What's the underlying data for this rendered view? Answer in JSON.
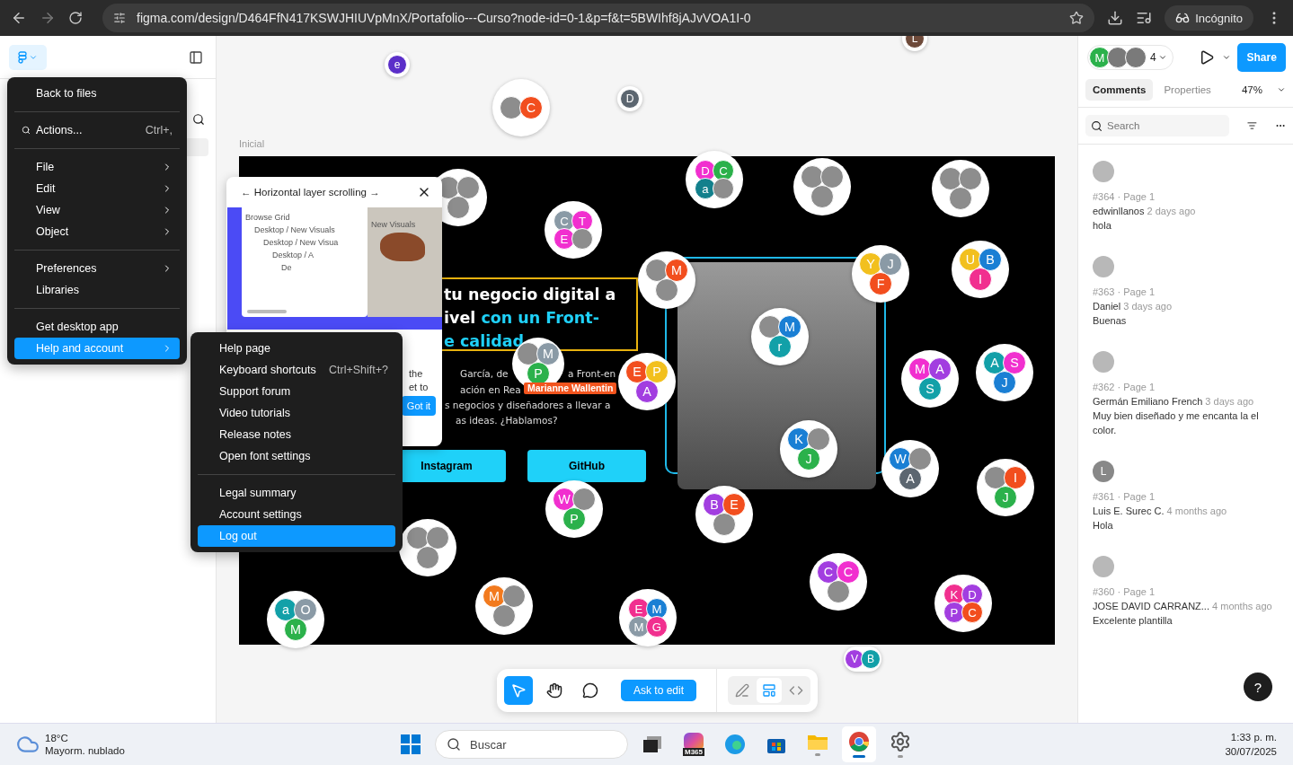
{
  "browser": {
    "url": "figma.com/design/D464FfN417KSWJHIUVpMnX/Portafolio---Curso?node-id=0-1&p=f&t=5BWIhf8jAJvVOA1I-0",
    "profile_label": "Incógnito"
  },
  "main_menu": {
    "groups": [
      [
        {
          "label": "Back to files",
          "submenu": false,
          "selected": false
        }
      ],
      [
        {
          "label": "Actions...",
          "shortcut": "Ctrl+,",
          "kind": "search",
          "submenu": false,
          "selected": false
        }
      ],
      [
        {
          "label": "File",
          "submenu": true,
          "selected": false
        },
        {
          "label": "Edit",
          "submenu": true,
          "selected": false
        },
        {
          "label": "View",
          "submenu": true,
          "selected": false
        },
        {
          "label": "Object",
          "submenu": true,
          "selected": false
        }
      ],
      [
        {
          "label": "Preferences",
          "submenu": true,
          "selected": false
        },
        {
          "label": "Libraries",
          "submenu": false,
          "selected": false
        }
      ],
      [
        {
          "label": "Get desktop app",
          "submenu": false,
          "selected": false
        },
        {
          "label": "Help and account",
          "submenu": true,
          "selected": true
        }
      ]
    ]
  },
  "help_menu": {
    "groups": [
      [
        {
          "label": "Help page",
          "selected": false
        },
        {
          "label": "Keyboard shortcuts",
          "shortcut": "Ctrl+Shift+?",
          "selected": false
        },
        {
          "label": "Support forum",
          "selected": false
        },
        {
          "label": "Video tutorials",
          "selected": false
        },
        {
          "label": "Release notes",
          "selected": false
        },
        {
          "label": "Open font settings",
          "selected": false
        }
      ],
      [
        {
          "label": "Legal summary",
          "selected": false
        },
        {
          "label": "Account settings",
          "selected": false
        },
        {
          "label": "Log out",
          "selected": true
        }
      ]
    ]
  },
  "canvas": {
    "frame_label": "Inicial",
    "headline": [
      [
        {
          "text": "tu negocio digital a",
          "accent": false
        }
      ],
      [
        {
          "text": "ivel ",
          "accent": false
        },
        {
          "text": "con un Front-",
          "accent": true
        }
      ],
      [
        {
          "text": "e calidad",
          "accent": true
        }
      ]
    ],
    "body_fragments": [
      "García, de",
      "a Front-en",
      "ación en Rea",
      "s negocios y diseñadores a llevar a",
      "as ideas. ¿Hablamos?"
    ],
    "buttons": [
      "Instagram",
      "GitHub"
    ],
    "cursor_label": "Marianne Wallentin",
    "tooltip": {
      "title": "← Horizontal layer scrolling →",
      "layers": [
        "Browse Grid",
        "Desktop / New Visuals",
        "Desktop / New Visua",
        "Desktop / A",
        "De"
      ],
      "preview_heading": "New Visuals",
      "body_fragments": [
        "the",
        "et to"
      ],
      "button": "Got it"
    },
    "bubbles": [
      [
        {
          "kind": "letter",
          "text": "e",
          "color": "#5b2fc9"
        }
      ],
      [
        {
          "kind": "photo"
        },
        {
          "kind": "letter",
          "text": "C",
          "color": "#f24e1e"
        }
      ],
      [
        {
          "kind": "letter",
          "text": "D",
          "color": "#5c6670"
        }
      ],
      [
        {
          "kind": "letter",
          "text": "L",
          "color": "#6e4a3a"
        }
      ],
      [
        {
          "kind": "photo"
        },
        {
          "kind": "photo"
        },
        {
          "kind": "photo"
        }
      ],
      [
        {
          "kind": "letter",
          "text": "C",
          "color": "#8a9aa6"
        },
        {
          "kind": "letter",
          "text": "T",
          "color": "#f12fcf"
        },
        {
          "kind": "letter",
          "text": "E",
          "color": "#f12fcf"
        },
        {
          "kind": "photo"
        }
      ],
      [
        {
          "kind": "letter",
          "text": "D",
          "color": "#f12fcf"
        },
        {
          "kind": "letter",
          "text": "C",
          "color": "#2bb14b"
        },
        {
          "kind": "letter",
          "text": "a",
          "color": "#12808c"
        },
        {
          "kind": "photo"
        }
      ],
      [
        {
          "kind": "photo"
        },
        {
          "kind": "photo"
        },
        {
          "kind": "photo"
        }
      ],
      [
        {
          "kind": "photo"
        },
        {
          "kind": "photo"
        },
        {
          "kind": "photo"
        }
      ],
      [
        {
          "kind": "photo"
        },
        {
          "kind": "letter",
          "text": "M",
          "color": "#f24e1e"
        },
        {
          "kind": "photo"
        }
      ],
      [
        {
          "kind": "letter",
          "text": "Y",
          "color": "#f2c01e"
        },
        {
          "kind": "letter",
          "text": "J",
          "color": "#8a9aa6"
        },
        {
          "kind": "letter",
          "text": "F",
          "color": "#f24e1e"
        }
      ],
      [
        {
          "kind": "letter",
          "text": "U",
          "color": "#f2c01e"
        },
        {
          "kind": "letter",
          "text": "B",
          "color": "#1a7fd4"
        },
        {
          "kind": "letter",
          "text": "I",
          "color": "#f12f8f"
        }
      ],
      [
        {
          "kind": "photo"
        },
        {
          "kind": "letter",
          "text": "M",
          "color": "#1a7fd4"
        },
        {
          "kind": "letter",
          "text": "r",
          "color": "#12a0a8"
        }
      ],
      [
        {
          "kind": "photo"
        },
        {
          "kind": "letter",
          "text": "M",
          "color": "#8a9aa6"
        },
        {
          "kind": "letter",
          "text": "P",
          "color": "#2bb14b"
        }
      ],
      [
        {
          "kind": "letter",
          "text": "E",
          "color": "#f24e1e"
        },
        {
          "kind": "letter",
          "text": "P",
          "color": "#f2c01e"
        },
        {
          "kind": "letter",
          "text": "A",
          "color": "#a23ee0"
        }
      ],
      [
        {
          "kind": "letter",
          "text": "M",
          "color": "#f12fcf"
        },
        {
          "kind": "letter",
          "text": "A",
          "color": "#a23ee0"
        },
        {
          "kind": "letter",
          "text": "S",
          "color": "#12a0a8"
        }
      ],
      [
        {
          "kind": "letter",
          "text": "A",
          "color": "#12a0a8"
        },
        {
          "kind": "letter",
          "text": "S",
          "color": "#f12fcf"
        },
        {
          "kind": "letter",
          "text": "J",
          "color": "#1a7fd4"
        }
      ],
      [
        {
          "kind": "letter",
          "text": "K",
          "color": "#1a7fd4"
        },
        {
          "kind": "photo"
        },
        {
          "kind": "letter",
          "text": "J",
          "color": "#2bb14b"
        }
      ],
      [
        {
          "kind": "letter",
          "text": "W",
          "color": "#1a7fd4"
        },
        {
          "kind": "photo"
        },
        {
          "kind": "letter",
          "text": "A",
          "color": "#5c6670"
        }
      ],
      [
        {
          "kind": "photo"
        },
        {
          "kind": "letter",
          "text": "I",
          "color": "#f24e1e"
        },
        {
          "kind": "letter",
          "text": "J",
          "color": "#2bb14b"
        }
      ],
      [
        {
          "kind": "letter",
          "text": "B",
          "color": "#a23ee0"
        },
        {
          "kind": "letter",
          "text": "E",
          "color": "#f24e1e"
        },
        {
          "kind": "photo"
        }
      ],
      [
        {
          "kind": "letter",
          "text": "W",
          "color": "#f12fcf"
        },
        {
          "kind": "photo"
        },
        {
          "kind": "letter",
          "text": "P",
          "color": "#2bb14b"
        }
      ],
      [
        {
          "kind": "photo"
        },
        {
          "kind": "photo"
        },
        {
          "kind": "photo"
        }
      ],
      [
        {
          "kind": "letter",
          "text": "C",
          "color": "#a23ee0"
        },
        {
          "kind": "letter",
          "text": "C",
          "color": "#f12fcf"
        },
        {
          "kind": "photo"
        }
      ],
      [
        {
          "kind": "letter",
          "text": "K",
          "color": "#f12f8f"
        },
        {
          "kind": "letter",
          "text": "D",
          "color": "#a23ee0"
        },
        {
          "kind": "letter",
          "text": "P",
          "color": "#a23ee0"
        },
        {
          "kind": "letter",
          "text": "C",
          "color": "#f24e1e"
        }
      ],
      [
        {
          "kind": "letter",
          "text": "M",
          "color": "#f27a1e"
        },
        {
          "kind": "photo"
        },
        {
          "kind": "photo"
        }
      ],
      [
        {
          "kind": "letter",
          "text": "E",
          "color": "#f12f8f"
        },
        {
          "kind": "letter",
          "text": "M",
          "color": "#1a7fd4"
        },
        {
          "kind": "letter",
          "text": "M",
          "color": "#8a9aa6"
        },
        {
          "kind": "letter",
          "text": "G",
          "color": "#f12f8f"
        }
      ],
      [
        {
          "kind": "letter",
          "text": "a",
          "color": "#12a0a8"
        },
        {
          "kind": "letter",
          "text": "O",
          "color": "#8a9aa6"
        },
        {
          "kind": "letter",
          "text": "M",
          "color": "#2bb14b"
        }
      ],
      [
        {
          "kind": "letter",
          "text": "V",
          "color": "#a23ee0"
        },
        {
          "kind": "letter",
          "text": "B",
          "color": "#12a0a8"
        }
      ]
    ]
  },
  "toolbar": {
    "tools": [
      {
        "kind": "move",
        "selected": true
      },
      {
        "kind": "hand",
        "selected": false
      },
      {
        "kind": "comment",
        "selected": false
      }
    ],
    "action": "Ask to edit",
    "modes": [
      {
        "kind": "draw",
        "selected": false
      },
      {
        "kind": "design",
        "selected": true
      },
      {
        "kind": "code",
        "selected": false
      }
    ]
  },
  "right_panel": {
    "collaborators": [
      {
        "kind": "letter",
        "text": "M",
        "color": "#2bb14b"
      },
      {
        "kind": "photo"
      },
      {
        "kind": "photo"
      }
    ],
    "collaborator_count": "4",
    "share": "Share",
    "tabs": [
      {
        "label": "Comments",
        "selected": true
      },
      {
        "label": "Properties",
        "selected": false
      }
    ],
    "zoom": "47%",
    "search": {
      "placeholder": "Search"
    },
    "comments": [
      {
        "meta": "#364 · Page 1",
        "author": "edwinllanos",
        "time": "2 days ago",
        "text": "hola"
      },
      {
        "meta": "#363 · Page 1",
        "author": "Daniel",
        "time": "3 days ago",
        "text": "Buenas"
      },
      {
        "meta": "#362 · Page 1",
        "author": "Germán Emiliano French",
        "time": "3 days ago",
        "text": "Muy bien diseñado y me encanta la el color."
      },
      {
        "meta": "#361 · Page 1",
        "author": "Luis E. Surec C.",
        "time": "4 months ago",
        "text": "Hola",
        "initial": "L"
      },
      {
        "meta": "#360 · Page 1",
        "author": "JOSE DAVID CARRANZ...",
        "time": "4 months ago",
        "text": "Excelente plantilla"
      }
    ]
  },
  "help_button": "?",
  "taskbar": {
    "weather": {
      "temp": "18°C",
      "condition": "Mayorm. nublado"
    },
    "search": "Buscar",
    "apps": [
      {
        "kind": "start",
        "running": false,
        "selected": false
      },
      {
        "kind": "taskview",
        "running": false,
        "selected": false
      },
      {
        "kind": "m365",
        "label": "M365",
        "running": false,
        "selected": false
      },
      {
        "kind": "edge",
        "running": false,
        "selected": false
      },
      {
        "kind": "store",
        "running": false,
        "selected": false
      },
      {
        "kind": "files",
        "running": true,
        "selected": false
      },
      {
        "kind": "chrome",
        "running": true,
        "selected": true
      },
      {
        "kind": "settings",
        "running": true,
        "selected": false
      }
    ],
    "time": "1:33 p. m.",
    "date": "30/07/2025"
  }
}
